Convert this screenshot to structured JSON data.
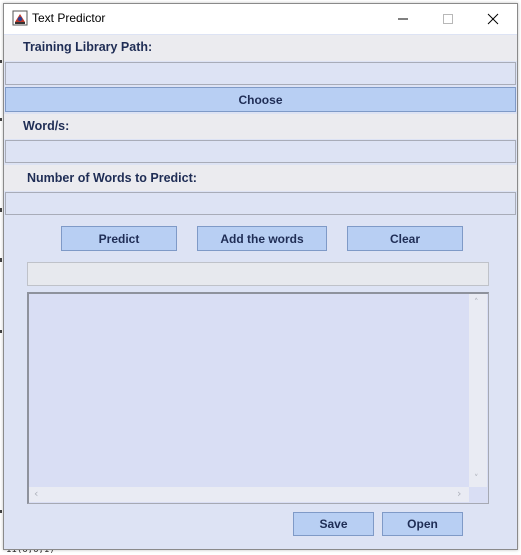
{
  "window": {
    "title": "Text Predictor"
  },
  "form": {
    "library_label": "Training Library Path:",
    "library_value": "",
    "choose_label": "Choose",
    "words_label": "Word/s:",
    "words_value": "",
    "count_label": "Number of Words to Predict:",
    "count_value": ""
  },
  "actions": {
    "predict_label": "Predict",
    "add_words_label": "Add the words",
    "clear_label": "Clear",
    "save_label": "Save",
    "open_label": "Open"
  },
  "output": {
    "result_value": "",
    "text_value": ""
  },
  "background": {
    "peek_text": "11(6,6;1)"
  },
  "colors": {
    "panel": "#dde3f4",
    "button": "#b8cff3",
    "label_text": "#1f2d55"
  },
  "icons": {
    "app": "app-icon",
    "minimize": "minimize-icon",
    "maximize": "maximize-icon",
    "close": "close-icon"
  }
}
